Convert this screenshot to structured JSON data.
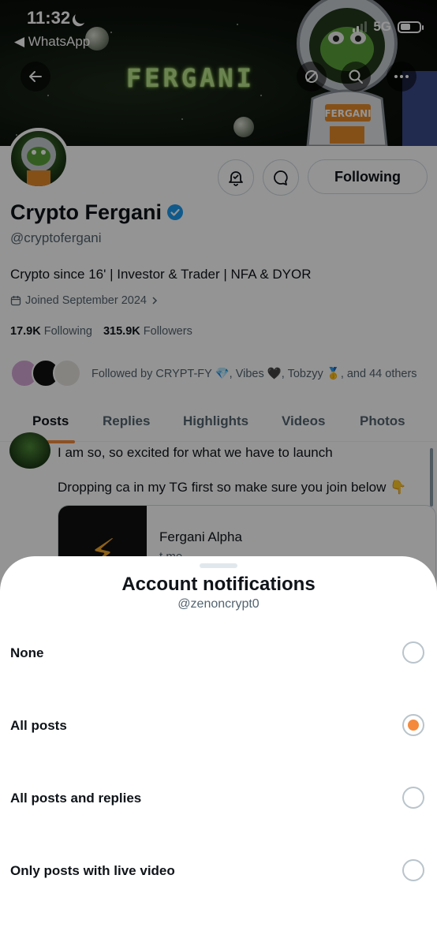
{
  "status_bar": {
    "time": "11:32",
    "back_app": "◀ WhatsApp",
    "network": "5G"
  },
  "banner": {
    "title": "FERGANI"
  },
  "profile": {
    "display_name": "Crypto Fergani",
    "handle": "@cryptofergani",
    "bio": "Crypto since 16' | Investor & Trader | NFA & DYOR",
    "joined": "Joined September 2024",
    "following_count": "17.9K",
    "following_label": "Following",
    "followers_count": "315.9K",
    "followers_label": "Followers",
    "followed_by": "Followed by CRYPT-FY 💎, Vibes 🖤, Tobzyy 🥇, and 44 others",
    "following_button": "Following"
  },
  "tabs": [
    {
      "label": "Posts"
    },
    {
      "label": "Replies"
    },
    {
      "label": "Highlights"
    },
    {
      "label": "Videos"
    },
    {
      "label": "Photos"
    }
  ],
  "post": {
    "line1": "I am so, so excited for what we have to launch",
    "line2": "Dropping ca in my TG first so make sure you join below 👇",
    "card_title": "Fergani Alpha",
    "card_domain": "t.me"
  },
  "sheet": {
    "title": "Account notifications",
    "subtitle": "@zenoncrypt0",
    "options": [
      {
        "label": "None",
        "selected": false
      },
      {
        "label": "All posts",
        "selected": true
      },
      {
        "label": "All posts and replies",
        "selected": false
      },
      {
        "label": "Only posts with live video",
        "selected": false
      }
    ]
  },
  "colors": {
    "accent": "#f48a3b",
    "verified": "#1d9bf0",
    "muted_text": "#536471"
  }
}
